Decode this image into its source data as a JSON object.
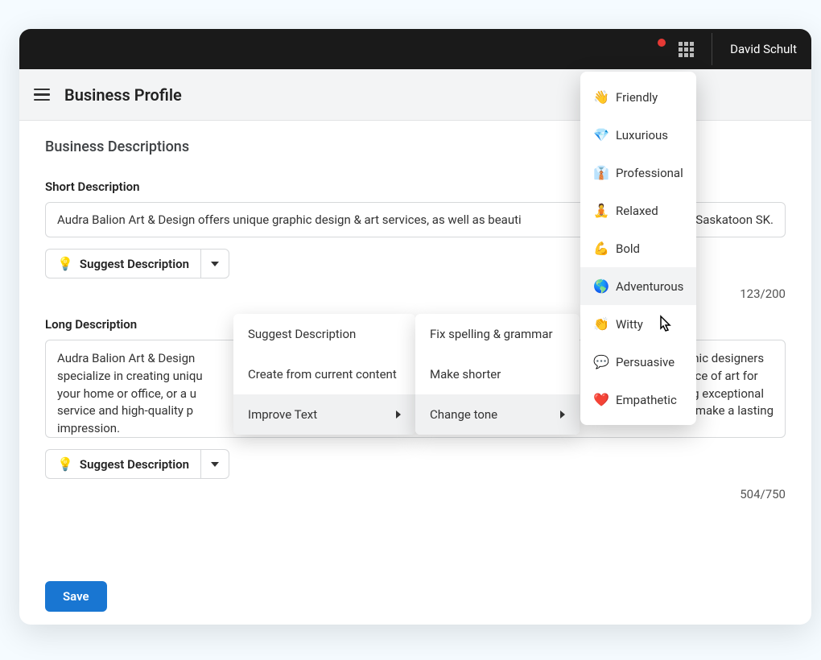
{
  "header": {
    "user_name": "David Schult",
    "page_title": "Business Profile"
  },
  "section": {
    "heading": "Business Descriptions"
  },
  "short": {
    "label": "Short Description",
    "value_left": "Audra Balion Art & Design offers unique graphic design & art services, as well as beauti",
    "value_right": "Saskatoon SK.",
    "suggest_label": "Suggest Description",
    "counter": "123/200"
  },
  "long": {
    "label": "Long Description",
    "value": "Audra Balion Art & Design\nspecialize in creating uniqu\nyour home or office, or a u\nservice and high-quality p\nimpression.",
    "value_right_lines": [
      "phic designers",
      "iece of art for",
      "ng exceptional",
      "u make a lasting"
    ],
    "suggest_label": "Suggest Description",
    "counter": "504/750"
  },
  "dropdown1": {
    "items": [
      "Suggest Description",
      "Create from current content",
      "Improve Text"
    ]
  },
  "dropdown2": {
    "items": [
      "Fix spelling & grammar",
      "Make shorter",
      "Change tone"
    ]
  },
  "tones": [
    {
      "emoji": "👋",
      "label": "Friendly"
    },
    {
      "emoji": "💎",
      "label": "Luxurious"
    },
    {
      "emoji": "👔",
      "label": "Professional"
    },
    {
      "emoji": "🧘",
      "label": "Relaxed"
    },
    {
      "emoji": "💪",
      "label": "Bold"
    },
    {
      "emoji": "🌎",
      "label": "Adventurous"
    },
    {
      "emoji": "👏",
      "label": "Witty"
    },
    {
      "emoji": "💬",
      "label": "Persuasive"
    },
    {
      "emoji": "❤️",
      "label": "Empathetic"
    }
  ],
  "buttons": {
    "save": "Save"
  },
  "icons": {
    "bulb": "💡"
  }
}
